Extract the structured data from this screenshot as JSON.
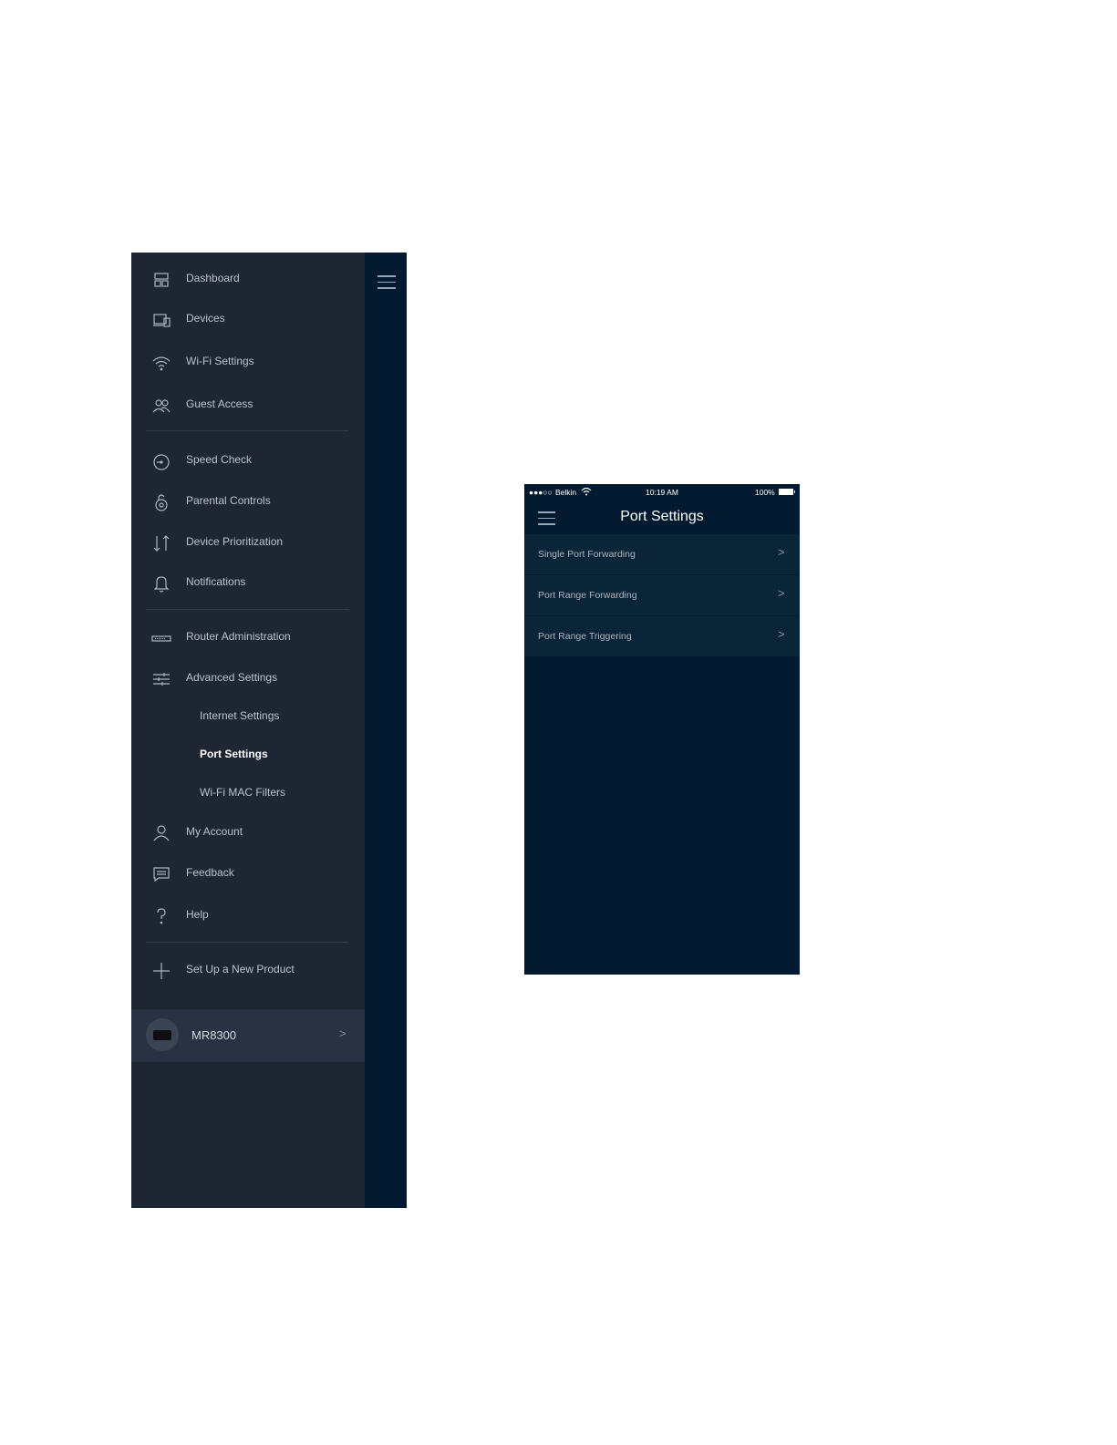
{
  "drawer": {
    "items": [
      {
        "label": "Dashboard",
        "icon": "dashboard-icon"
      },
      {
        "label": "Devices",
        "icon": "devices-icon"
      },
      {
        "label": "Wi-Fi Settings",
        "icon": "wifi-icon"
      },
      {
        "label": "Guest Access",
        "icon": "guest-access-icon"
      },
      {
        "label": "Speed Check",
        "icon": "speedometer-icon"
      },
      {
        "label": "Parental Controls",
        "icon": "padlock-icon"
      },
      {
        "label": "Device Prioritization",
        "icon": "up-down-arrows-icon"
      },
      {
        "label": "Notifications",
        "icon": "bell-icon"
      },
      {
        "label": "Router Administration",
        "icon": "router-icon"
      },
      {
        "label": "Advanced Settings",
        "icon": "sliders-icon"
      },
      {
        "label": "Internet Settings"
      },
      {
        "label": "Port Settings",
        "active": true
      },
      {
        "label": "Wi-Fi MAC Filters"
      },
      {
        "label": "My Account",
        "icon": "person-icon"
      },
      {
        "label": "Feedback",
        "icon": "chat-bubble-icon"
      },
      {
        "label": "Help",
        "icon": "question-mark-icon"
      },
      {
        "label": "Set Up a New Product",
        "icon": "plus-icon"
      }
    ],
    "product": {
      "label": "MR8300",
      "chevron": ">"
    }
  },
  "phone": {
    "status_bar": {
      "signal": "●●●○○",
      "carrier": "Belkin",
      "time": "10:19 AM",
      "battery": "100%"
    },
    "title": "Port Settings",
    "rows": [
      {
        "label": "Single Port Forwarding",
        "chevron": ">"
      },
      {
        "label": "Port Range Forwarding",
        "chevron": ">"
      },
      {
        "label": "Port Range Triggering",
        "chevron": ">"
      }
    ]
  },
  "colors": {
    "drawer_background": "#1e2633",
    "screen_background": "#011a30",
    "list_row_background": "#0a2438",
    "text_muted": "#b9c1cb",
    "text_active": "#ffffff"
  }
}
